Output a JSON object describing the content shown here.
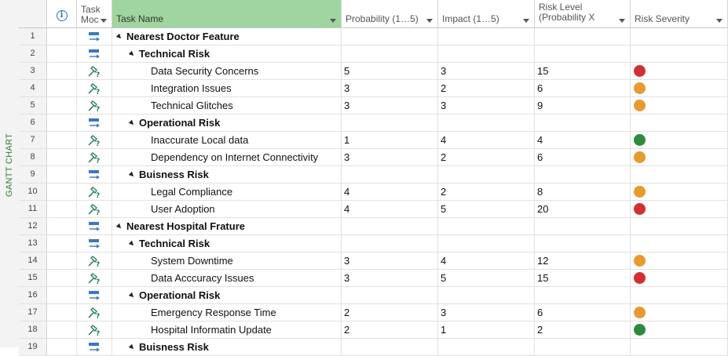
{
  "sidebar": {
    "label": "GANTT CHART"
  },
  "columns": {
    "info": "i",
    "mode": "Task Moc",
    "name": "Task Name",
    "probability": "Probability (1…5)",
    "impact": "Impact (1…5)",
    "risk_level": "Risk Level (Probability X",
    "severity": "Risk Severity"
  },
  "colors": {
    "red": "#d32f2f",
    "orange": "#e89a2c",
    "green": "#2e8b3e",
    "selected_header": "#9fd59f"
  },
  "rows": [
    {
      "id": "1",
      "mode": "auto",
      "level": 0,
      "summary": true,
      "name": "Nearest Doctor Feature",
      "prob": "",
      "impact": "",
      "risk": "",
      "sev": ""
    },
    {
      "id": "2",
      "mode": "auto",
      "level": 1,
      "summary": true,
      "name": "Technical Risk",
      "prob": "",
      "impact": "",
      "risk": "",
      "sev": ""
    },
    {
      "id": "3",
      "mode": "manual",
      "level": 2,
      "summary": false,
      "name": "Data Security Concerns",
      "prob": "5",
      "impact": "3",
      "risk": "15",
      "sev": "red"
    },
    {
      "id": "4",
      "mode": "manual",
      "level": 2,
      "summary": false,
      "name": "Integration Issues",
      "prob": "3",
      "impact": "2",
      "risk": "6",
      "sev": "orange"
    },
    {
      "id": "5",
      "mode": "manual",
      "level": 2,
      "summary": false,
      "name": "Technical Glitches",
      "prob": "3",
      "impact": "3",
      "risk": "9",
      "sev": "orange"
    },
    {
      "id": "6",
      "mode": "auto",
      "level": 1,
      "summary": true,
      "name": "Operational Risk",
      "prob": "",
      "impact": "",
      "risk": "",
      "sev": ""
    },
    {
      "id": "7",
      "mode": "manual",
      "level": 2,
      "summary": false,
      "name": "Inaccurate Local data",
      "prob": "1",
      "impact": "4",
      "risk": "4",
      "sev": "green"
    },
    {
      "id": "8",
      "mode": "manual",
      "level": 2,
      "summary": false,
      "name": "Dependency on Internet Connectivity",
      "prob": "3",
      "impact": "2",
      "risk": "6",
      "sev": "orange"
    },
    {
      "id": "9",
      "mode": "auto",
      "level": 1,
      "summary": true,
      "name": "Buisness Risk",
      "prob": "",
      "impact": "",
      "risk": "",
      "sev": ""
    },
    {
      "id": "10",
      "mode": "manual",
      "level": 2,
      "summary": false,
      "name": "Legal Compliance",
      "prob": "4",
      "impact": "2",
      "risk": "8",
      "sev": "orange"
    },
    {
      "id": "11",
      "mode": "manual",
      "level": 2,
      "summary": false,
      "name": "User Adoption",
      "prob": "4",
      "impact": "5",
      "risk": "20",
      "sev": "red"
    },
    {
      "id": "12",
      "mode": "auto",
      "level": 0,
      "summary": true,
      "name": "Nearest Hospital Frature",
      "prob": "",
      "impact": "",
      "risk": "",
      "sev": ""
    },
    {
      "id": "13",
      "mode": "auto",
      "level": 1,
      "summary": true,
      "name": "Technical Risk",
      "prob": "",
      "impact": "",
      "risk": "",
      "sev": ""
    },
    {
      "id": "14",
      "mode": "manual",
      "level": 2,
      "summary": false,
      "name": "System Downtime",
      "prob": "3",
      "impact": "4",
      "risk": "12",
      "sev": "orange"
    },
    {
      "id": "15",
      "mode": "manual",
      "level": 2,
      "summary": false,
      "name": "Data Acccuracy Issues",
      "prob": "3",
      "impact": "5",
      "risk": "15",
      "sev": "red"
    },
    {
      "id": "16",
      "mode": "auto",
      "level": 1,
      "summary": true,
      "name": "Operational Risk",
      "prob": "",
      "impact": "",
      "risk": "",
      "sev": ""
    },
    {
      "id": "17",
      "mode": "manual",
      "level": 2,
      "summary": false,
      "name": "Emergency Response Time",
      "prob": "2",
      "impact": "3",
      "risk": "6",
      "sev": "orange"
    },
    {
      "id": "18",
      "mode": "manual",
      "level": 2,
      "summary": false,
      "name": "Hospital Informatin Update",
      "prob": "2",
      "impact": "1",
      "risk": "2",
      "sev": "green"
    },
    {
      "id": "19",
      "mode": "auto",
      "level": 1,
      "summary": true,
      "name": "Buisness Risk",
      "prob": "",
      "impact": "",
      "risk": "",
      "sev": ""
    }
  ]
}
